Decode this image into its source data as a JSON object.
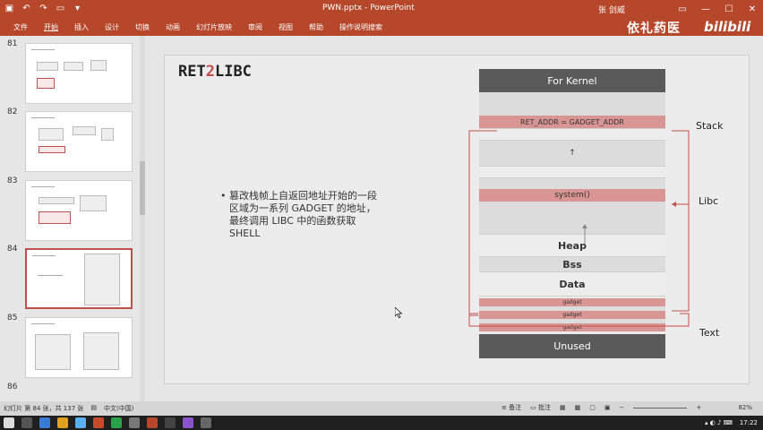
{
  "titlebar": {
    "doc_title": "PWN.pptx - PowerPoint",
    "user": "张 剑威",
    "qat_icons": [
      "save-icon",
      "undo-icon",
      "redo-icon",
      "present-icon",
      "customize-icon"
    ]
  },
  "ribbon": {
    "tabs": [
      "文件",
      "开始",
      "插入",
      "设计",
      "切换",
      "动画",
      "幻灯片放映",
      "审阅",
      "视图",
      "帮助",
      "操作说明搜索"
    ],
    "active_tab": 1,
    "brand": "依礼药医",
    "bili": "bilibili"
  },
  "thumbnails": [
    {
      "num": "81"
    },
    {
      "num": "82"
    },
    {
      "num": "83"
    },
    {
      "num": "84"
    },
    {
      "num": "85"
    },
    {
      "num": "86"
    }
  ],
  "slide": {
    "title_pre": "RET",
    "title_accent": "2",
    "title_post": "LIBC",
    "bullet": "篡改栈帧上自返回地址开始的一段区域为一系列 GADGET 的地址，最终调用 LIBC 中的函数获取 SHELL"
  },
  "stack": {
    "kernel": "For Kernel",
    "ret": "RET_ADDR = GADGET_ADDR",
    "arrow1": "↑",
    "system": "system()",
    "heap": "Heap",
    "bss": "Bss",
    "data": "Data",
    "gadget1": "gadget",
    "gadget2": "gadget",
    "gadget3": "gadget",
    "unused": "Unused",
    "label_stack": "Stack",
    "label_libc": "Libc",
    "label_text": "Text"
  },
  "status": {
    "slide_info": "幻灯片 第 84 张，共 137 张",
    "lang": "中文(中国)",
    "notes": "备注",
    "comments": "批注",
    "zoom": "82%"
  },
  "taskbar": {
    "time": "17:22"
  },
  "colors": {
    "accent": "#b7472a",
    "stack_red": "#d99594",
    "stack_dark": "#5a5a5a"
  }
}
